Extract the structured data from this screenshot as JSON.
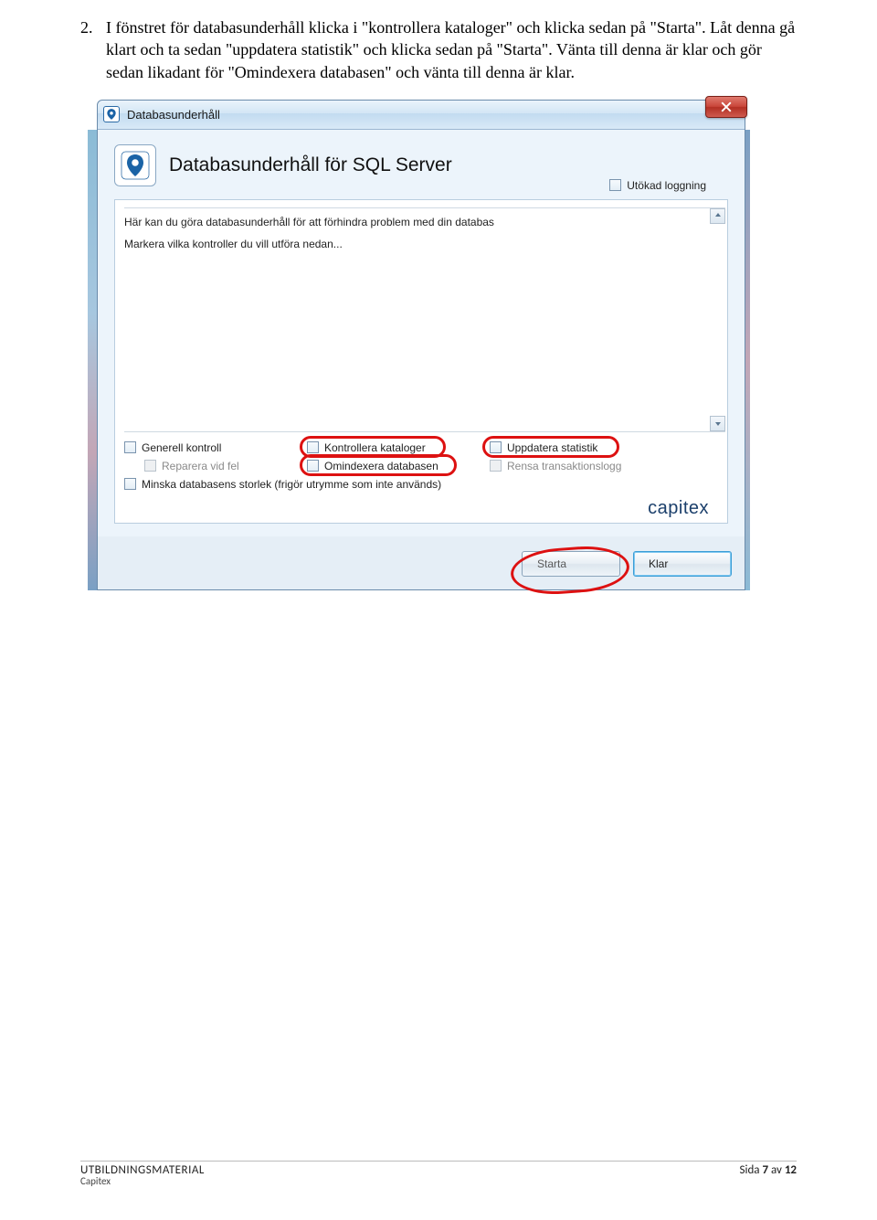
{
  "instruction": {
    "number": "2.",
    "text": "I fönstret för databasunderhåll klicka i \"kontrollera kataloger\" och klicka sedan på \"Starta\". Låt denna gå klart och ta sedan \"uppdatera statistik\" och klicka sedan på \"Starta\". Vänta till denna är klar och gör sedan likadant för \"Omindexera databasen\" och vänta till denna är klar."
  },
  "window": {
    "title": "Databasunderhåll",
    "header": "Databasunderhåll för SQL Server",
    "extended_logging": "Utökad loggning",
    "messages": {
      "line1": "Här kan du göra databasunderhåll för att förhindra problem med din databas",
      "line2": "Markera vilka kontroller du vill utföra nedan..."
    },
    "checks": {
      "general": "Generell kontroll",
      "repair": "Reparera vid fel",
      "catalogs": "Kontrollera kataloger",
      "reindex": "Omindexera databasen",
      "stats": "Uppdatera statistik",
      "translog": "Rensa transaktionslogg",
      "shrink": "Minska databasens storlek (frigör utrymme som inte används)"
    },
    "brand": "capitex",
    "buttons": {
      "start": "Starta",
      "done": "Klar"
    }
  },
  "footer": {
    "left_top": "UTBILDNINGSMATERIAL",
    "left_bottom": "Capitex",
    "right_prefix": "Sida ",
    "right_page": "7",
    "right_mid": " av ",
    "right_total": "12"
  }
}
